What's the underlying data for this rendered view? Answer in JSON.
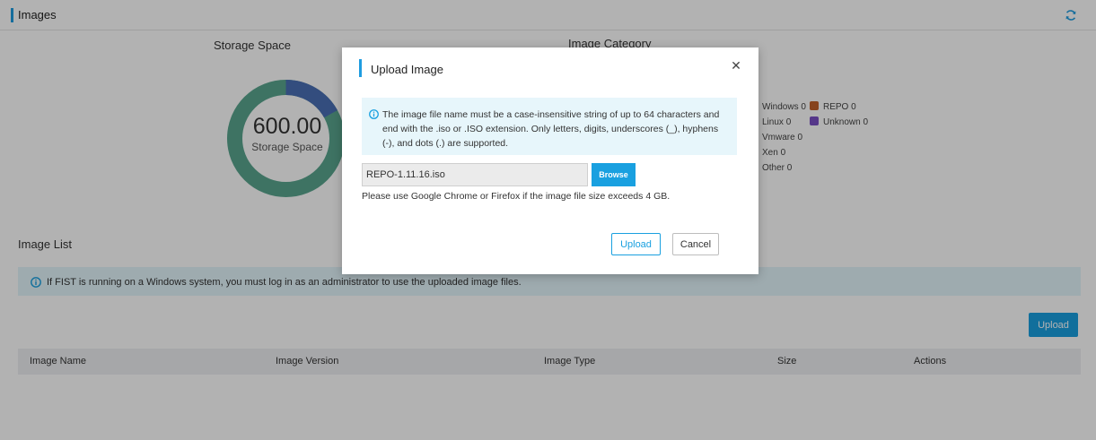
{
  "header": {
    "title": "Images"
  },
  "storage": {
    "title": "Storage Space",
    "value": "600.00",
    "label": "Storage Space",
    "used_fraction": 0.17
  },
  "category": {
    "title": "Image Category",
    "legend": [
      {
        "label": "Windows",
        "count": "0",
        "color": "#4a6fb5"
      },
      {
        "label": "Linux",
        "count": "0",
        "color": "#5aa58e"
      },
      {
        "label": "Vmware",
        "count": "0",
        "color": "#e0a030"
      },
      {
        "label": "Xen",
        "count": "0",
        "color": "#d05050"
      },
      {
        "label": "Other",
        "count": "0",
        "color": "#888888"
      },
      {
        "label": "REPO",
        "count": "0",
        "color": "#c0602a"
      },
      {
        "label": "Unknown",
        "count": "0",
        "color": "#7a4fc5"
      }
    ]
  },
  "image_list": {
    "title": "Image List",
    "info": "If FIST is running on a Windows system, you must log in as an administrator to use the uploaded image files.",
    "upload_label": "Upload",
    "columns": [
      "Image Name",
      "Image Version",
      "Image Type",
      "Size",
      "Actions"
    ]
  },
  "modal": {
    "title": "Upload Image",
    "note": "The image file name must be a case-insensitive string of up to 64 characters and end with the .iso or .ISO extension. Only letters, digits, underscores (_), hyphens (-), and dots (.) are supported.",
    "file_value": "REPO-1.11.16.iso",
    "browse_label": "Browse",
    "hint": "Please use Google Chrome or Firefox if the image file size exceeds 4 GB.",
    "upload_label": "Upload",
    "cancel_label": "Cancel"
  },
  "colors": {
    "accent": "#19a0e0",
    "donut_used": "#4a6fb5",
    "donut_free": "#5aa58e"
  }
}
